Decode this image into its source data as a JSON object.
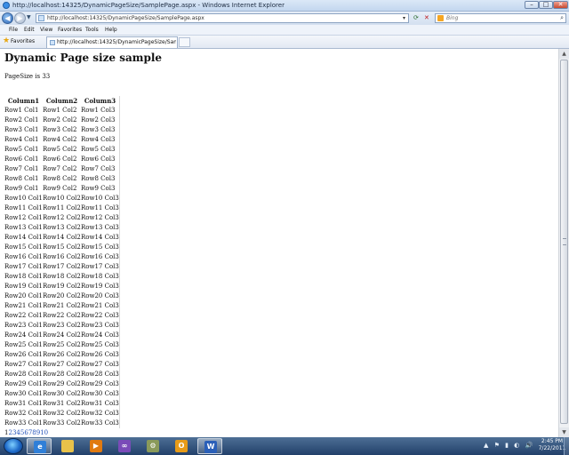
{
  "window": {
    "title": "http://localhost:14325/DynamicPageSize/SamplePage.aspx - Windows Internet Explorer",
    "minimize": "–",
    "maximize": "□",
    "close": "✕"
  },
  "navbar": {
    "back": "◀",
    "forward": "▶",
    "history": "▼",
    "url": "http://localhost:14325/DynamicPageSize/SamplePage.aspx",
    "refresh": "⟳",
    "stop": "✕",
    "search_placeholder": "Bing",
    "search_icon": "magnifier-icon"
  },
  "menu": [
    "File",
    "Edit",
    "View",
    "Favorites",
    "Tools",
    "Help"
  ],
  "favbar": {
    "favorites": "Favorites",
    "tab_title": "http://localhost:14325/DynamicPageSize/Sample..."
  },
  "page": {
    "title": "Dynamic Page size sample",
    "pagesize": "PageSize is 33",
    "grid": {
      "headers": [
        "Column1",
        "Column2",
        "Column3"
      ],
      "rows": [
        [
          "Row1 Col1",
          "Row1 Col2",
          "Row1 Col3"
        ],
        [
          "Row2 Col1",
          "Row2 Col2",
          "Row2 Col3"
        ],
        [
          "Row3 Col1",
          "Row3 Col2",
          "Row3 Col3"
        ],
        [
          "Row4 Col1",
          "Row4 Col2",
          "Row4 Col3"
        ],
        [
          "Row5 Col1",
          "Row5 Col2",
          "Row5 Col3"
        ],
        [
          "Row6 Col1",
          "Row6 Col2",
          "Row6 Col3"
        ],
        [
          "Row7 Col1",
          "Row7 Col2",
          "Row7 Col3"
        ],
        [
          "Row8 Col1",
          "Row8 Col2",
          "Row8 Col3"
        ],
        [
          "Row9 Col1",
          "Row9 Col2",
          "Row9 Col3"
        ],
        [
          "Row10 Col1",
          "Row10 Col2",
          "Row10 Col3"
        ],
        [
          "Row11 Col1",
          "Row11 Col2",
          "Row11 Col3"
        ],
        [
          "Row12 Col1",
          "Row12 Col2",
          "Row12 Col3"
        ],
        [
          "Row13 Col1",
          "Row13 Col2",
          "Row13 Col3"
        ],
        [
          "Row14 Col1",
          "Row14 Col2",
          "Row14 Col3"
        ],
        [
          "Row15 Col1",
          "Row15 Col2",
          "Row15 Col3"
        ],
        [
          "Row16 Col1",
          "Row16 Col2",
          "Row16 Col3"
        ],
        [
          "Row17 Col1",
          "Row17 Col2",
          "Row17 Col3"
        ],
        [
          "Row18 Col1",
          "Row18 Col2",
          "Row18 Col3"
        ],
        [
          "Row19 Col1",
          "Row19 Col2",
          "Row19 Col3"
        ],
        [
          "Row20 Col1",
          "Row20 Col2",
          "Row20 Col3"
        ],
        [
          "Row21 Col1",
          "Row21 Col2",
          "Row21 Col3"
        ],
        [
          "Row22 Col1",
          "Row22 Col2",
          "Row22 Col3"
        ],
        [
          "Row23 Col1",
          "Row23 Col2",
          "Row23 Col3"
        ],
        [
          "Row24 Col1",
          "Row24 Col2",
          "Row24 Col3"
        ],
        [
          "Row25 Col1",
          "Row25 Col2",
          "Row25 Col3"
        ],
        [
          "Row26 Col1",
          "Row26 Col2",
          "Row26 Col3"
        ],
        [
          "Row27 Col1",
          "Row27 Col2",
          "Row27 Col3"
        ],
        [
          "Row28 Col1",
          "Row28 Col2",
          "Row28 Col3"
        ],
        [
          "Row29 Col1",
          "Row29 Col2",
          "Row29 Col3"
        ],
        [
          "Row30 Col1",
          "Row30 Col2",
          "Row30 Col3"
        ],
        [
          "Row31 Col1",
          "Row31 Col2",
          "Row31 Col3"
        ],
        [
          "Row32 Col1",
          "Row32 Col2",
          "Row32 Col3"
        ],
        [
          "Row33 Col1",
          "Row33 Col2",
          "Row33 Col3"
        ]
      ]
    },
    "pager": [
      "1",
      "2",
      "3",
      "4",
      "5",
      "6",
      "7",
      "8",
      "9",
      "10"
    ],
    "current_page": "1"
  },
  "taskbar": {
    "items": [
      {
        "name": "ie-icon",
        "glyph": "e",
        "color": "#2f7fd8",
        "active": true
      },
      {
        "name": "explorer-folder-icon",
        "glyph": "",
        "color": "#e8c24a",
        "active": false
      },
      {
        "name": "media-player-icon",
        "glyph": "▶",
        "color": "#e07a10",
        "active": false
      },
      {
        "name": "visual-studio-icon",
        "glyph": "∞",
        "color": "#7a4bb8",
        "active": false
      },
      {
        "name": "network-tool-icon",
        "glyph": "⚙",
        "color": "#8a9a5a",
        "active": false
      },
      {
        "name": "outlook-icon",
        "glyph": "O",
        "color": "#e79b18",
        "active": false
      },
      {
        "name": "word-icon",
        "glyph": "W",
        "color": "#2a5fb8",
        "active": true
      }
    ],
    "tray_icons": "▲ ⚑ ▮ ◐ 🔊",
    "time": "2:45 PM",
    "date": "7/22/2011"
  }
}
